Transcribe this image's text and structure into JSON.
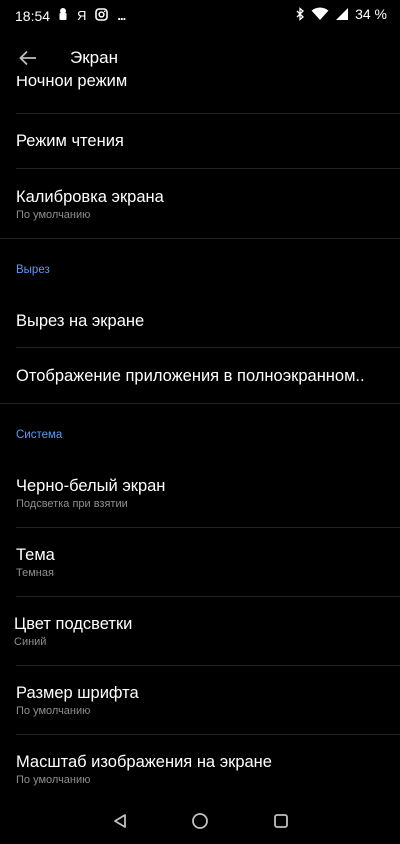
{
  "status_bar": {
    "time": "18:54",
    "app_icon_ya": "Я",
    "more_indicator": "...",
    "battery": "34 %"
  },
  "app_bar": {
    "title": "Экран"
  },
  "items": [
    {
      "title": "Ночной режим",
      "summary": ""
    },
    {
      "title": "Режим чтения",
      "summary": ""
    },
    {
      "title": "Калибровка экрана",
      "summary": "По умолчанию"
    },
    {
      "title": "Вырез на экране",
      "summary": ""
    },
    {
      "title": "Отображение приложения в полноэкранном..",
      "summary": ""
    },
    {
      "title": "Черно-белый экран",
      "summary": "Подсветка при взятии"
    },
    {
      "title": "Тема",
      "summary": "Темная"
    },
    {
      "title": "Цвет подсветки",
      "summary": "Синий"
    },
    {
      "title": "Размер шрифта",
      "summary": "По умолчанию"
    },
    {
      "title": "Масштаб изображения на экране",
      "summary": "По умолчанию"
    }
  ],
  "sections": {
    "cutout": "Вырез",
    "system": "Система"
  },
  "colors": {
    "background": "#000000",
    "accent": "#5b9bf5",
    "divider": "#222222",
    "secondary_text": "#8f8f8f"
  }
}
